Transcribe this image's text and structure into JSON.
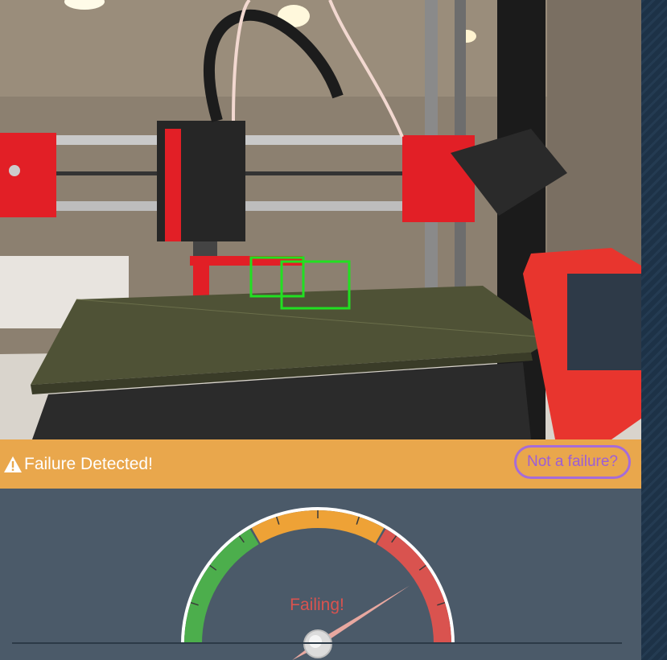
{
  "alert": {
    "icon": "warning-triangle-icon",
    "text": "Failure Detected!",
    "button_label": "Not a failure?"
  },
  "gauge": {
    "status_text": "Failing!",
    "level_fraction": 0.82,
    "zones": [
      "good",
      "warning",
      "failing"
    ]
  },
  "colors": {
    "alert_bar": "#e9a74c",
    "button_outline": "#a66cd8",
    "gauge_good": "#4cae4c",
    "gauge_warning": "#eea236",
    "gauge_failing": "#d9534f",
    "panel": "#4b5a69",
    "detection_box": "#21e021"
  }
}
